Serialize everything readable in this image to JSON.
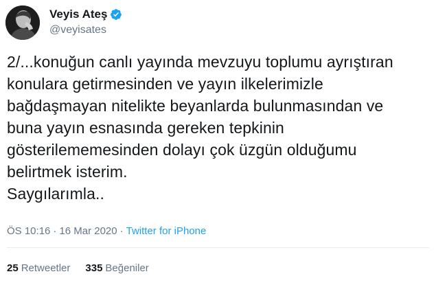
{
  "tweet": {
    "author": {
      "display_name": "Veyis Ateş",
      "handle": "@veyisates",
      "verified": true,
      "avatar_icon": "profile-photo"
    },
    "text": "2/...konuğun canlı yayında mevzuyu toplumu ayrıştıran\nkonulara getirmesinden ve yayın ilkelerimizle\nbağdaşmayan nitelikte beyanlarda bulunmasından ve\nbuna yayın esnasında gereken tepkinin\ngösterilememesinden dolayı çok üzgün olduğumu\nbelirtmek isterim.\nSaygılarımla..",
    "time": "ÖS 10:16",
    "separator": "·",
    "date": "16 Mar 2020",
    "source": "Twitter for iPhone",
    "stats": {
      "retweets_count": "25",
      "retweets_label": "Retweetler",
      "likes_count": "335",
      "likes_label": "Beğeniler"
    },
    "colors": {
      "link": "#1da1f2",
      "muted": "#657786",
      "text": "#14171a",
      "verified_badge": "#1da1f2"
    }
  }
}
